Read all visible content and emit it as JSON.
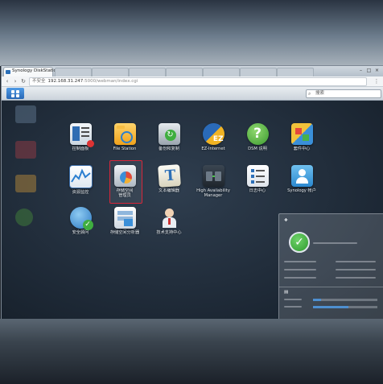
{
  "browser": {
    "tab_title": "Synology DiskStation",
    "address": {
      "insecure_label": "不安全",
      "host": "192.168.31.247",
      "path": ":5000/webman/index.cgi"
    },
    "nav": {
      "back": "‹",
      "forward": "›",
      "reload": "↻",
      "menu": "⋮"
    },
    "window_buttons": {
      "minimize": "–",
      "maximize": "□",
      "close": "×"
    }
  },
  "taskbar": {
    "search_placeholder": "搜索"
  },
  "apps": [
    {
      "label": "控制面板",
      "icon": "control-panel-icon"
    },
    {
      "label": "File Station",
      "icon": "folder-icon"
    },
    {
      "label": "备份和复制",
      "icon": "backup-replication-icon"
    },
    {
      "label": "EZ-Internet",
      "icon": "ez-internet-icon"
    },
    {
      "label": "DSM 说明",
      "icon": "help-icon"
    },
    {
      "label": "套件中心",
      "icon": "package-center-icon"
    },
    {
      "label": "资源监控",
      "icon": "resource-monitor-icon"
    },
    {
      "label": "存储空间\n管理员",
      "icon": "storage-manager-icon"
    },
    {
      "label": "文本编辑器",
      "icon": "text-editor-icon"
    },
    {
      "label": "High Availability\nManager",
      "icon": "high-availability-icon"
    },
    {
      "label": "日志中心",
      "icon": "log-center-icon"
    },
    {
      "label": "Synology 帐户",
      "icon": "synology-account-icon"
    },
    {
      "label": "安全顾问",
      "icon": "security-advisor-icon"
    },
    {
      "label": "存储空间分析器",
      "icon": "storage-analyzer-icon"
    },
    {
      "label": "技术支持中心",
      "icon": "support-center-icon"
    }
  ],
  "colors": {
    "accent": "#2767b5",
    "selection_frame": "#d9263a",
    "status_ok": "#2e9a2e"
  }
}
